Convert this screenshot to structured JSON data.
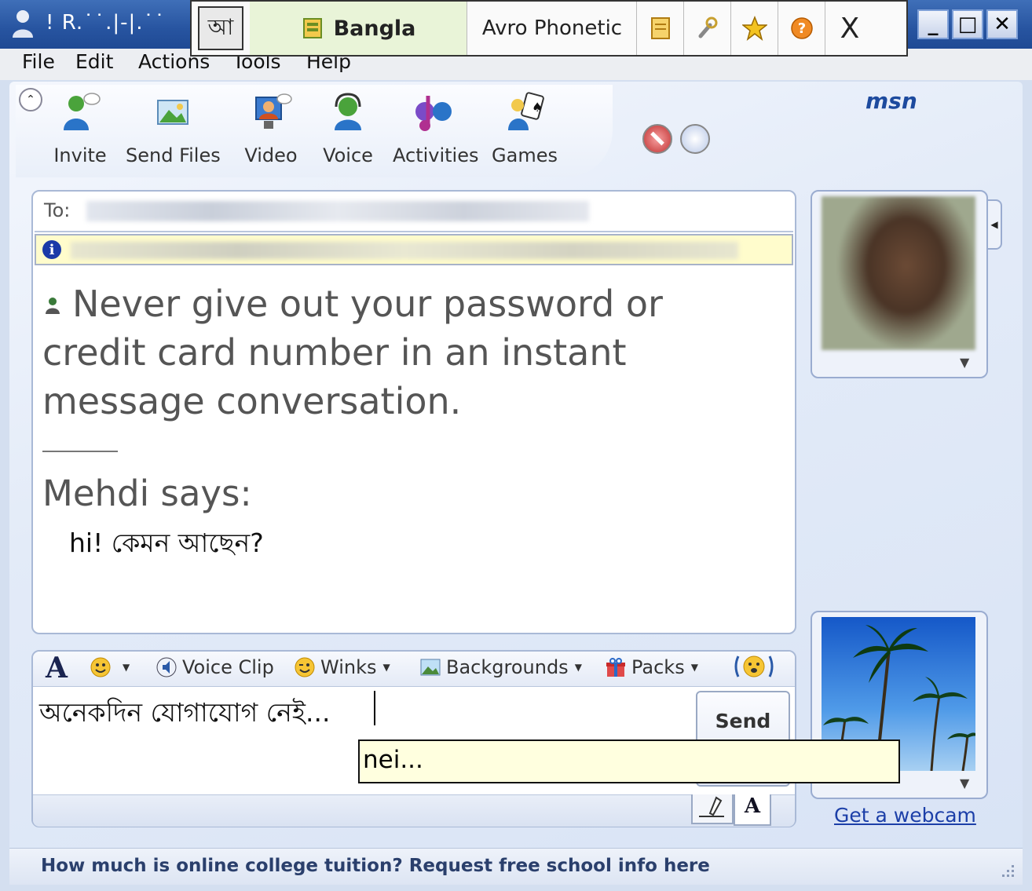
{
  "window": {
    "title": "! R.˙˙.|-|.˙˙",
    "minimize_glyph": "_",
    "maximize_glyph": "□",
    "close_glyph": "✕"
  },
  "avro": {
    "mode_glyph": "আ",
    "language": "Bangla",
    "layout": "Avro Phonetic",
    "close_glyph": "X",
    "icons": [
      "notepad-icon",
      "tools-icon",
      "star-icon",
      "help-icon"
    ],
    "suggestion": "nei..."
  },
  "menu": {
    "items": [
      "File",
      "Edit",
      "Actions",
      "Tools",
      "Help"
    ]
  },
  "toolbar": {
    "buttons": [
      {
        "label": "Invite",
        "icon": "invite-icon"
      },
      {
        "label": "Send Files",
        "icon": "send-files-icon"
      },
      {
        "label": "Video",
        "icon": "video-icon"
      },
      {
        "label": "Voice",
        "icon": "voice-icon"
      },
      {
        "label": "Activities",
        "icon": "activities-icon"
      },
      {
        "label": "Games",
        "icon": "games-icon"
      }
    ],
    "logo": "msn"
  },
  "conversation": {
    "to_label": "To:",
    "warning": "Never give out your password or credit card number in an instant message conversation.",
    "sender": "Mehdi says:",
    "message": "hi! কেমন আছেন?"
  },
  "compose": {
    "toolbar": {
      "font_glyph": "A",
      "voice_clip": "Voice Clip",
      "winks": "Winks",
      "backgrounds": "Backgrounds",
      "packs": "Packs"
    },
    "input_text": "অনেকদিন যোগাযোগ নেই...",
    "send_label": "Send",
    "type_tab_glyph": "A"
  },
  "sidebar": {
    "webcam_link": "Get a webcam"
  },
  "status": {
    "ad_text": "How much is online college tuition? Request free school info here"
  },
  "colors": {
    "title_bar": "#2754a0",
    "avro_lang_bg": "#e9f4d8",
    "info_bar": "#fffccc",
    "suggestion_bg": "#ffffdf",
    "link": "#1c3fa8"
  }
}
